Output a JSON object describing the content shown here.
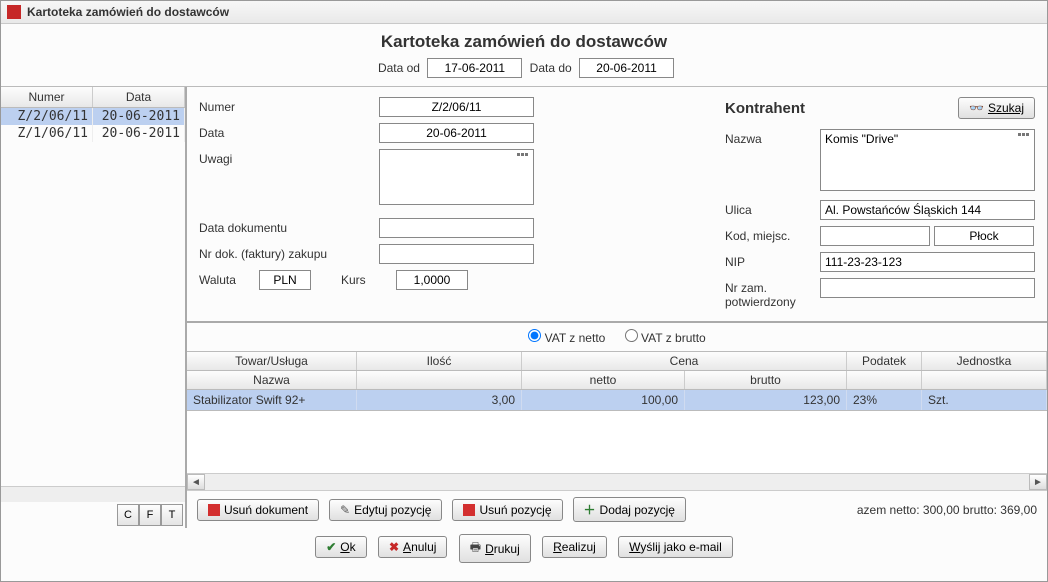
{
  "window_title": "Kartoteka zamówień do dostawców",
  "header_title": "Kartoteka zamówień do dostawców",
  "date_from_label": "Data od",
  "date_to_label": "Data do",
  "date_from": "17-06-2011",
  "date_to": "20-06-2011",
  "left_grid": {
    "col_numer": "Numer",
    "col_data": "Data",
    "rows": [
      {
        "numer": "Z/2/06/11",
        "data": "20-06-2011",
        "selected": true
      },
      {
        "numer": "Z/1/06/11",
        "data": "20-06-2011",
        "selected": false
      }
    ],
    "btn_c": "C",
    "btn_f": "F",
    "btn_t": "T"
  },
  "form": {
    "numer_label": "Numer",
    "numer": "Z/2/06/11",
    "data_label": "Data",
    "data": "20-06-2011",
    "uwagi_label": "Uwagi",
    "uwagi": "",
    "data_dok_label": "Data dokumentu",
    "data_dok": "",
    "nr_dok_label": "Nr dok. (faktury) zakupu",
    "nr_dok": "",
    "waluta_label": "Waluta",
    "waluta": "PLN",
    "kurs_label": "Kurs",
    "kurs": "1,0000"
  },
  "kontrahent": {
    "title": "Kontrahent",
    "szukaj": "Szukaj",
    "nazwa_label": "Nazwa",
    "nazwa": "Komis \"Drive\"",
    "ulica_label": "Ulica",
    "ulica": "Al. Powstańców Śląskich 144",
    "kod_label": "Kod, miejsc.",
    "kod": "",
    "miejsc": "Płock",
    "nip_label": "NIP",
    "nip": "111-23-23-123",
    "nrzam_label": "Nr zam. potwierdzony",
    "nrzam": ""
  },
  "vat": {
    "z_netto": "VAT z netto",
    "z_brutto": "VAT z brutto",
    "selected": "netto"
  },
  "items": {
    "head_towar": "Towar/Usługa",
    "head_ilosc": "Ilość",
    "head_cena": "Cena",
    "head_podatek": "Podatek",
    "head_jedn": "Jednostka",
    "head_nazwa": "Nazwa",
    "head_netto": "netto",
    "head_brutto": "brutto",
    "rows": [
      {
        "nazwa": "Stabilizator Swift 92+",
        "ilosc": "3,00",
        "netto": "100,00",
        "brutto": "123,00",
        "podatek": "23%",
        "jedn": "Szt."
      }
    ]
  },
  "actions": {
    "usun_dok": "Usuń dokument",
    "edytuj": "Edytuj pozycję",
    "usun_poz": "Usuń pozycję",
    "dodaj_poz": "Dodaj pozycję",
    "totals": "azem netto: 300,00 brutto: 369,00"
  },
  "bottom": {
    "ok": "Ok",
    "anuluj": "Anuluj",
    "drukuj": "Drukuj",
    "realizuj": "Realizuj",
    "email": "Wyślij jako e-mail"
  }
}
